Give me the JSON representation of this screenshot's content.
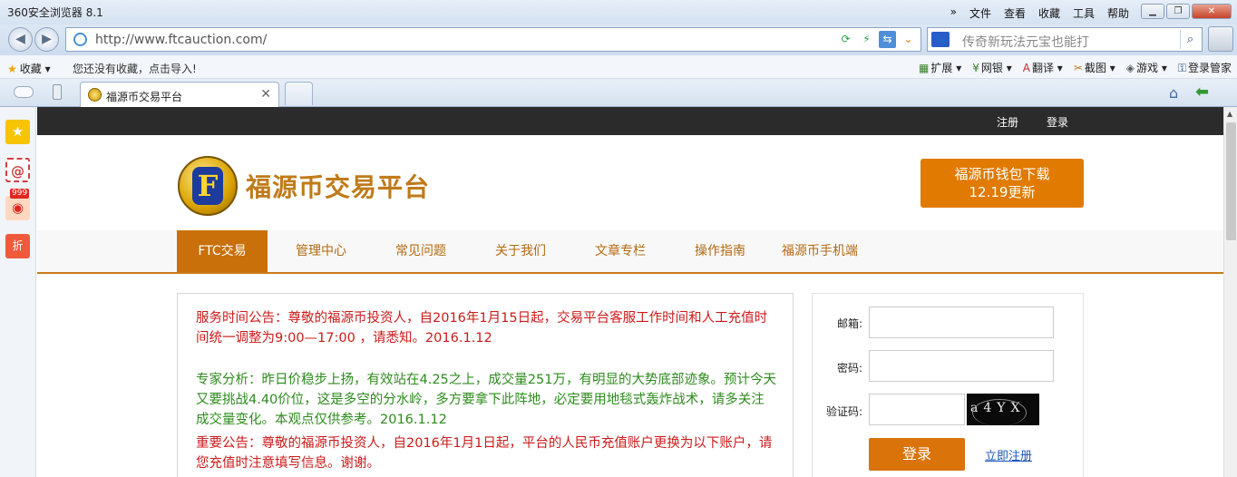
{
  "browser": {
    "title": "360安全浏览器 8.1",
    "menu": [
      "»",
      "文件",
      "查看",
      "收藏",
      "工具",
      "帮助"
    ],
    "url": "http://www.ftcauction.com/",
    "search_hint": "传奇新玩法元宝也能打",
    "favorites_label": "收藏",
    "import_hint": "您还没有收藏，点击导入!",
    "tools": [
      "扩展",
      "网银",
      "翻译",
      "截图",
      "游戏",
      "登录管家"
    ],
    "tab_title": "福源币交易平台",
    "weibo_count": "999",
    "zhe_label": "折"
  },
  "site": {
    "top_links": [
      "注册",
      "登录"
    ],
    "logo_letter": "F",
    "title": "福源币交易平台",
    "download_line1": "福源币钱包下载",
    "download_line2": "12.19更新",
    "nav": [
      "FTC交易",
      "管理中心",
      "常见问题",
      "关于我们",
      "文章专栏",
      "操作指南",
      "福源币手机端"
    ]
  },
  "announcements": [
    "服务时间公告：尊敬的福源币投资人，自2016年1月15日起，交易平台客服工作时间和人工充值时间统一调整为9:00—17:00 ，请悉知。2016.1.12",
    "专家分析：昨日价稳步上扬，有效站在4.25之上，成交量251万，有明显的大势底部迹象。预计今天又要挑战4.40价位，这是多空的分水岭，多方要拿下此阵地，必定要用地毯式轰炸战术，请多关注成交量变化。本观点仅供参考。2016.1.12",
    "重要公告：尊敬的福源币投资人，自2016年1月1日起，平台的人民币充值账户更换为以下账户，请您充值时注意填写信息。谢谢。"
  ],
  "login": {
    "email_label": "邮箱:",
    "password_label": "密码:",
    "captcha_label": "验证码:",
    "captcha_text": "a4YX",
    "submit": "登录",
    "register": "立即注册"
  }
}
